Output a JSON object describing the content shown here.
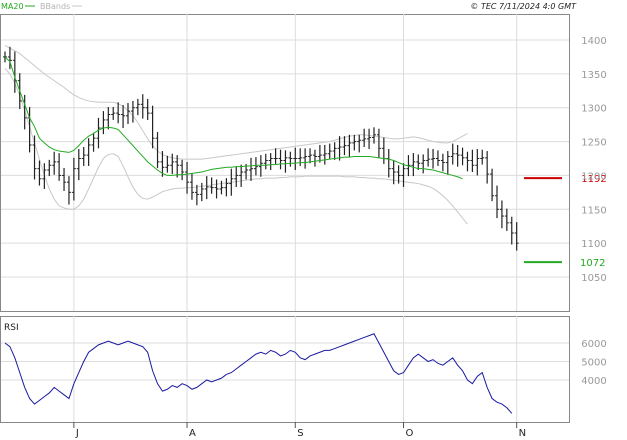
{
  "header": {
    "legend_ma": "MA20",
    "legend_bbands": "BBands",
    "copyright": "© TEC 7/11/2024 4:0 GMT"
  },
  "colors": {
    "ma": "#22aa22",
    "bbands": "#c8c8c8",
    "candles": "#222222",
    "resistance": "#cc0000",
    "support": "#22aa22",
    "rsi_line": "#1a1aa0",
    "grid": "#dcdcdc"
  },
  "chart_data": [
    {
      "type": "ohlc",
      "ylim": [
        1000,
        1450
      ],
      "y_ticks": [
        "1400",
        "1350",
        "1300",
        "1250",
        "1200",
        "1150",
        "1100",
        "1050"
      ],
      "x_ticks": [
        "J",
        "A",
        "S",
        "O",
        "N"
      ],
      "x_tick_index": [
        14,
        37,
        59,
        81,
        104
      ],
      "resistance": {
        "label": "1192",
        "value": 1196
      },
      "support": {
        "label": "1072",
        "value": 1072
      },
      "close": [
        1375,
        1370,
        1340,
        1310,
        1285,
        1245,
        1210,
        1195,
        1208,
        1215,
        1220,
        1200,
        1190,
        1175,
        1210,
        1225,
        1230,
        1245,
        1255,
        1270,
        1282,
        1290,
        1292,
        1290,
        1288,
        1295,
        1300,
        1305,
        1300,
        1292,
        1255,
        1220,
        1212,
        1215,
        1220,
        1215,
        1205,
        1190,
        1175,
        1172,
        1180,
        1183,
        1182,
        1180,
        1182,
        1188,
        1195,
        1200,
        1205,
        1208,
        1210,
        1213,
        1218,
        1222,
        1225,
        1225,
        1222,
        1226,
        1225,
        1225,
        1226,
        1228,
        1230,
        1228,
        1230,
        1232,
        1236,
        1240,
        1242,
        1244,
        1248,
        1250,
        1252,
        1254,
        1256,
        1260,
        1240,
        1225,
        1210,
        1205,
        1200,
        1210,
        1215,
        1220,
        1218,
        1222,
        1224,
        1225,
        1222,
        1219,
        1228,
        1232,
        1230,
        1226,
        1222,
        1215,
        1225,
        1226,
        1202,
        1170,
        1150,
        1140,
        1130,
        1115,
        1100
      ],
      "ma20": [
        1375,
        1368,
        1345,
        1325,
        1305,
        1285,
        1272,
        1255,
        1248,
        1242,
        1238,
        1236,
        1235,
        1234,
        1237,
        1244,
        1252,
        1258,
        1262,
        1267,
        1270,
        1271,
        1270,
        1268,
        1260,
        1252,
        1244,
        1236,
        1228,
        1220,
        1214,
        1208,
        1203,
        1200,
        1200,
        1201,
        1201,
        1202,
        1203,
        1204,
        1205,
        1207,
        1209,
        1210,
        1211,
        1212,
        1212,
        1213,
        1213,
        1214,
        1214,
        1215,
        1215,
        1215,
        1216,
        1216,
        1217,
        1217,
        1218,
        1218,
        1219,
        1219,
        1220,
        1221,
        1222,
        1223,
        1224,
        1225,
        1226,
        1227,
        1227,
        1228,
        1228,
        1228,
        1228,
        1227,
        1226,
        1225,
        1224,
        1222,
        1219,
        1216,
        1214,
        1212,
        1210,
        1210,
        1209,
        1208,
        1206,
        1204,
        1202,
        1200,
        1198,
        1195
      ],
      "bb_upper": [
        1392,
        1388,
        1384,
        1380,
        1374,
        1368,
        1362,
        1356,
        1350,
        1345,
        1340,
        1335,
        1330,
        1324,
        1319,
        1315,
        1312,
        1310,
        1309,
        1308,
        1308,
        1308,
        1308,
        1306,
        1302,
        1296,
        1288,
        1278,
        1266,
        1254,
        1244,
        1236,
        1231,
        1228,
        1226,
        1225,
        1224,
        1224,
        1224,
        1224,
        1224,
        1225,
        1226,
        1227,
        1228,
        1229,
        1230,
        1231,
        1232,
        1233,
        1234,
        1235,
        1236,
        1237,
        1238,
        1239,
        1240,
        1241,
        1242,
        1243,
        1244,
        1245,
        1246,
        1247,
        1248,
        1249,
        1250,
        1252,
        1254,
        1256,
        1258,
        1259,
        1260,
        1260,
        1259,
        1258,
        1257,
        1256,
        1255,
        1254,
        1254,
        1255,
        1256,
        1257,
        1256,
        1254,
        1252,
        1250,
        1249,
        1248,
        1248,
        1250,
        1254,
        1258,
        1262
      ],
      "bb_lower": [
        1358,
        1350,
        1336,
        1318,
        1296,
        1272,
        1248,
        1224,
        1200,
        1180,
        1165,
        1155,
        1152,
        1150,
        1150,
        1155,
        1165,
        1180,
        1196,
        1212,
        1225,
        1231,
        1232,
        1228,
        1214,
        1198,
        1183,
        1172,
        1166,
        1165,
        1168,
        1172,
        1176,
        1178,
        1180,
        1181,
        1181,
        1182,
        1182,
        1183,
        1184,
        1185,
        1186,
        1187,
        1188,
        1189,
        1190,
        1191,
        1192,
        1193,
        1194,
        1195,
        1195,
        1196,
        1196,
        1196,
        1197,
        1197,
        1198,
        1198,
        1198,
        1199,
        1199,
        1199,
        1199,
        1199,
        1199,
        1199,
        1199,
        1198,
        1198,
        1198,
        1197,
        1197,
        1196,
        1196,
        1195,
        1195,
        1194,
        1193,
        1192,
        1191,
        1190,
        1189,
        1188,
        1186,
        1184,
        1181,
        1176,
        1170,
        1163,
        1155,
        1146,
        1137,
        1128
      ]
    },
    {
      "type": "line",
      "title": "RSI",
      "ylim": [
        20,
        80
      ],
      "y_ticks": [
        "6000",
        "5000",
        "4000"
      ],
      "y_tick_values": [
        60,
        50,
        40
      ],
      "values": [
        60,
        58,
        52,
        44,
        36,
        30,
        27,
        29,
        31,
        33,
        36,
        34,
        32,
        30,
        38,
        44,
        50,
        55,
        57,
        59,
        60,
        61,
        60,
        59,
        60,
        61,
        60,
        59,
        58,
        55,
        45,
        38,
        34,
        35,
        37,
        36,
        38,
        37,
        35,
        36,
        38,
        40,
        39,
        40,
        41,
        43,
        44,
        46,
        48,
        50,
        52,
        54,
        55,
        54,
        56,
        55,
        53,
        54,
        56,
        55,
        52,
        51,
        53,
        54,
        55,
        56,
        56,
        57,
        58,
        59,
        60,
        61,
        62,
        63,
        64,
        65,
        60,
        55,
        50,
        45,
        43,
        44,
        48,
        52,
        54,
        52,
        50,
        51,
        49,
        48,
        50,
        52,
        48,
        45,
        40,
        38,
        42,
        44,
        36,
        30,
        28,
        27,
        25,
        22
      ]
    }
  ]
}
